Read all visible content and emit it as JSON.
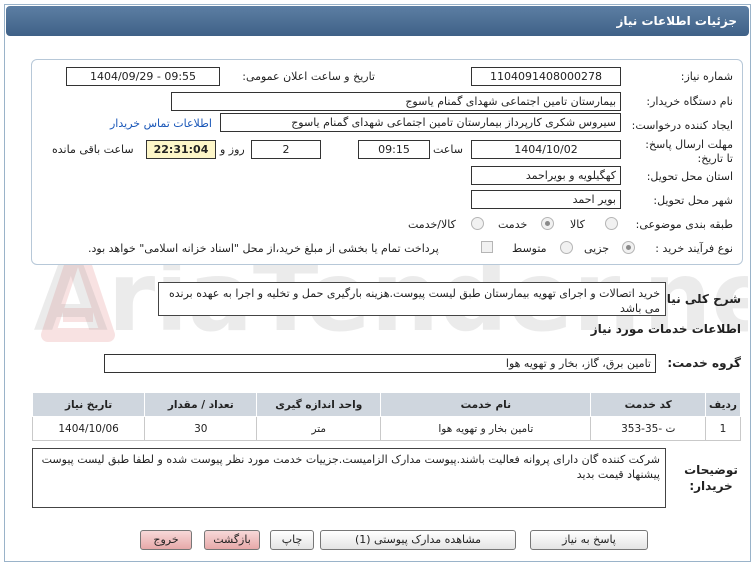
{
  "header": {
    "title": "جزئیات اطلاعات نیاز"
  },
  "watermark": {
    "text": "AriaTender.net"
  },
  "fields": {
    "need_number_label": "شماره نیاز:",
    "need_number": "1104091408000278",
    "announce_label": "تاریخ و ساعت اعلان عمومی:",
    "announce_value": "1404/09/29 - 09:55",
    "buyer_org_label": "نام دستگاه خریدار:",
    "buyer_org": "بیمارستان تامین اجتماعی شهدای گمنام یاسوج",
    "requester_label": "ایجاد کننده درخواست:",
    "requester": "سیروس شکری کارپرداز بیمارستان تامین اجتماعی شهدای گمنام یاسوج",
    "contact_link": "اطلاعات تماس خریدار",
    "deadline_label": "مهلت ارسال پاسخ: تا تاریخ:",
    "deadline_date": "1404/10/02",
    "time_label": "ساعت",
    "deadline_time": "09:15",
    "days_value": "2",
    "days_label": "روز و",
    "remaining_time": "22:31:04",
    "remaining_label": "ساعت باقی مانده",
    "province_label": "استان محل تحویل:",
    "province": "کهگیلویه و بویراحمد",
    "city_label": "شهر محل تحویل:",
    "city": "بویر احمد",
    "category_label": "طبقه بندی موضوعی:",
    "category_options": [
      "کالا",
      "خدمت",
      "کالا/خدمت"
    ],
    "purchase_type_label": "نوع فرآیند خرید :",
    "purchase_options": [
      "جزیی",
      "متوسط"
    ],
    "purchase_note": "پرداخت تمام یا بخشی از مبلغ خرید،از محل \"اسناد خزانه اسلامی\" خواهد بود."
  },
  "description": {
    "label": "شرح کلی نیاز:",
    "text": "خرید اتصالات و اجرای تهویه بیمارستان طبق لیست پیوست.هزینه بارگیری حمل و تخلیه و اجرا به عهده برنده می باشد"
  },
  "services": {
    "section_title": "اطلاعات خدمات مورد نیاز",
    "group_label": "گروه خدمت:",
    "group_value": "تامین برق، گاز، بخار و تهویه هوا",
    "columns": [
      "ردیف",
      "کد خدمت",
      "نام خدمت",
      "واحد اندازه گیری",
      "تعداد / مقدار",
      "تاریخ نیاز"
    ],
    "rows": [
      [
        "1",
        "ت -35-353",
        "تامین بخار و تهویه هوا",
        "متر",
        "30",
        "1404/10/06"
      ]
    ]
  },
  "buyer_notes": {
    "label": "توضیحات خریدار:",
    "text": "شرکت کننده گان دارای پروانه فعالیت باشند.پیوست مدارک الزامیست.جزییات خدمت مورد نظر پیوست شده و لطفا طبق لیست پیوست پیشنهاد قیمت بدید"
  },
  "buttons": {
    "reply": "پاسخ به نیاز",
    "attachments": "مشاهده مدارک پیوستی (1)",
    "print": "چاپ",
    "back": "بازگشت",
    "exit": "خروج"
  },
  "colors": {
    "header": "#4a6d94",
    "link": "#1a57b8",
    "timer_bg": "#fdf6c8"
  }
}
